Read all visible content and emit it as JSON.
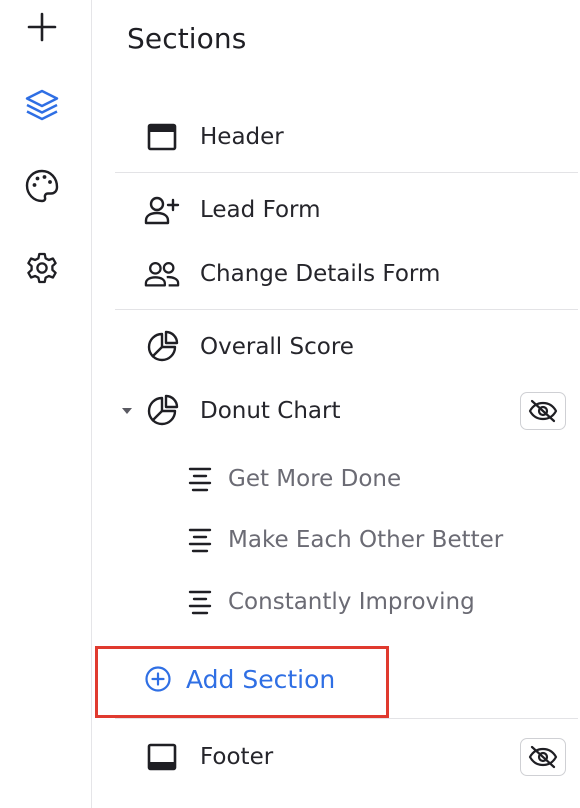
{
  "rail": {
    "items": [
      {
        "icon": "plus-icon"
      },
      {
        "icon": "layers-icon",
        "active": true
      },
      {
        "icon": "palette-icon"
      },
      {
        "icon": "gear-icon"
      }
    ]
  },
  "panel": {
    "title": "Sections",
    "sections": [
      {
        "label": "Header",
        "icon": "header-layout-icon"
      },
      {
        "label": "Lead Form",
        "icon": "user-plus-icon"
      },
      {
        "label": "Change Details Form",
        "icon": "users-icon"
      },
      {
        "label": "Overall Score",
        "icon": "pie-chart-icon"
      },
      {
        "label": "Donut Chart",
        "icon": "pie-chart-icon",
        "expanded": true,
        "hidden": true
      },
      {
        "label": "Get More Done",
        "icon": "align-center-icon"
      },
      {
        "label": "Make Each Other Better",
        "icon": "align-center-icon"
      },
      {
        "label": "Constantly Improving",
        "icon": "align-center-icon"
      },
      {
        "label": "Footer",
        "icon": "footer-layout-icon",
        "hidden": true
      }
    ],
    "add_section_label": "Add Section"
  },
  "colors": {
    "accent": "#2f6fe4",
    "highlight_border": "#e03a2f",
    "divider": "#e3e3e6",
    "sub_text": "#6b6b74"
  }
}
